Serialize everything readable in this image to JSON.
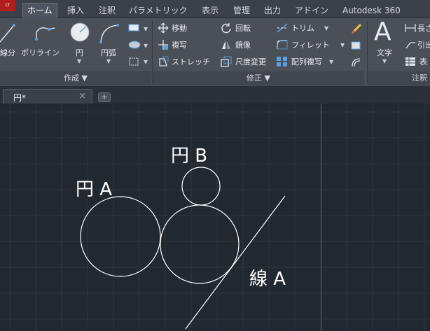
{
  "app": {
    "logo_text": "LT"
  },
  "ribbon_tabs": [
    "ホーム",
    "挿入",
    "注釈",
    "パラメトリック",
    "表示",
    "管理",
    "出力",
    "アドイン",
    "Autodesk 360"
  ],
  "draw_panel": {
    "title": "作成",
    "tools": {
      "line_partial": "線分",
      "polyline": "ポリライン",
      "circle": "円",
      "arc": "円弧"
    }
  },
  "modify_panel": {
    "title": "修正",
    "move": "移動",
    "rotate": "回転",
    "trim": "トリム",
    "copy": "複写",
    "mirror": "鏡像",
    "fillet": "フィレット",
    "stretch": "ストレッチ",
    "scale": "尺度変更",
    "array": "配列複写"
  },
  "annotation_panel": {
    "title": "注釈",
    "text": "文字",
    "dim_linear_partial": "長さ",
    "leader_partial": "引出",
    "table_partial": "表"
  },
  "document": {
    "tab_label": "円*",
    "close_glyph": "×",
    "new_tab_glyph": "+"
  },
  "drawing": {
    "labels": {
      "circle_a": "円 A",
      "circle_b": "円 B",
      "line_a": "線 A"
    },
    "line_color": "#ffffff",
    "grid_color": "#2e3640",
    "axis_color": "#3a6b3a"
  },
  "colors": {
    "ribbon_bg": "#4a4f58",
    "canvas_bg": "#212830",
    "tab_active": "#4f5560"
  }
}
